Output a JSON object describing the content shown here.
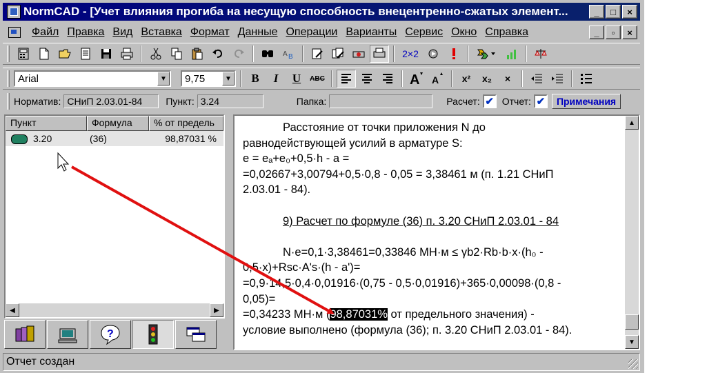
{
  "window": {
    "title": "NormCAD - [Учет влияния прогиба на несущую способность внецентренно-сжатых элемент...",
    "caption_min": "_",
    "caption_max": "□",
    "caption_close": "×"
  },
  "menu": {
    "items": [
      "Файл",
      "Правка",
      "Вид",
      "Вставка",
      "Формат",
      "Данные",
      "Операции",
      "Варианты",
      "Сервис",
      "Окно",
      "Справка"
    ],
    "mdi_min": "_",
    "mdi_restore": "▫",
    "mdi_close": "×"
  },
  "toolbar1": {
    "zoom_label": "2×2"
  },
  "toolbar2": {
    "font_name": "Arial",
    "font_size": "9,75",
    "bold": "B",
    "italic": "I",
    "underline": "U",
    "strike": "ABC",
    "superscript": "x²",
    "subscript": "x₂",
    "clear": "×"
  },
  "info": {
    "norm_label": "Норматив:",
    "norm_value": "СНиП 2.03.01-84",
    "point_label": "Пункт:",
    "point_value": "3.24",
    "folder_label": "Папка:",
    "folder_value": "",
    "calc_label": "Расчет:",
    "report_label": "Отчет:",
    "notes_button": "Примечания"
  },
  "left_panel": {
    "columns": [
      "Пункт",
      "Формула",
      "% от предель"
    ],
    "rows": [
      {
        "point": "3.20",
        "formula": "(36)",
        "percent": "98,87031 %"
      }
    ]
  },
  "document": {
    "lines": [
      "Расстояние от точки приложения N до",
      "равнодействующей усилий в арматуре S:",
      "e = eₐ+e₀+0,5·h - a =",
      "=0,02667+3,00794+0,5·0,8 - 0,05 = 3,38461 м (п. 1.21 СНиП",
      "2.03.01 - 84).",
      "",
      "9) Расчет по формуле (36) п. 3.20 СНиП 2.03.01 - 84",
      "",
      "N·e=0,1·3,38461=0,33846 МН·м ≤ γb2·Rb·b·x·(h₀ -",
      "0,5·x)+Rsc·A's·(h - a')=",
      "=0,9·14,5·0,4·0,01916·(0,75 - 0,5·0,01916)+365·0,00098·(0,8 -",
      "0,05)=",
      "=0,34233 МН·м (",
      "условие выполнено (формула (36); п. 3.20 СНиП 2.03.01 - 84)."
    ],
    "highlight": "98,87031%",
    "after_highlight": " от предельного значения)  -"
  },
  "status": {
    "text": "Отчет создан"
  },
  "colors": {
    "title_bar": "#000080",
    "annotation_arrow": "#e01010",
    "window_face": "#c0c0c0"
  }
}
